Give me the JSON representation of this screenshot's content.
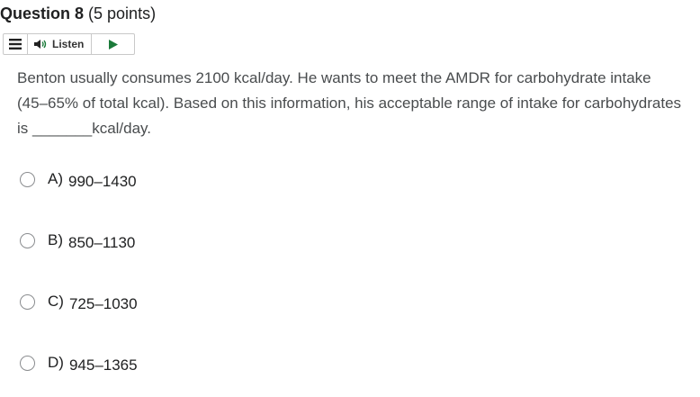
{
  "question": {
    "title": "Question 8",
    "points": "(5 points)"
  },
  "listen_toolbar": {
    "menu_icon": "menu-icon",
    "speaker_icon": "speaker-icon",
    "listen_label": "Listen",
    "play_icon": "play-icon",
    "accent_color": "#1b7a3a"
  },
  "body": {
    "text_before_blank": "Benton usually consumes 2100 kcal/day. He wants to meet the AMDR for carbohydrate intake (45–65% of total kcal). Based on this information, his acceptable range of intake for carbohydrates is ",
    "blank": "_______",
    "text_after_blank": "kcal/day."
  },
  "choices": [
    {
      "letter": "A)",
      "value": "990–1430"
    },
    {
      "letter": "B)",
      "value": "850–1130"
    },
    {
      "letter": "C)",
      "value": "725–1030"
    },
    {
      "letter": "D)",
      "value": "945–1365"
    }
  ]
}
